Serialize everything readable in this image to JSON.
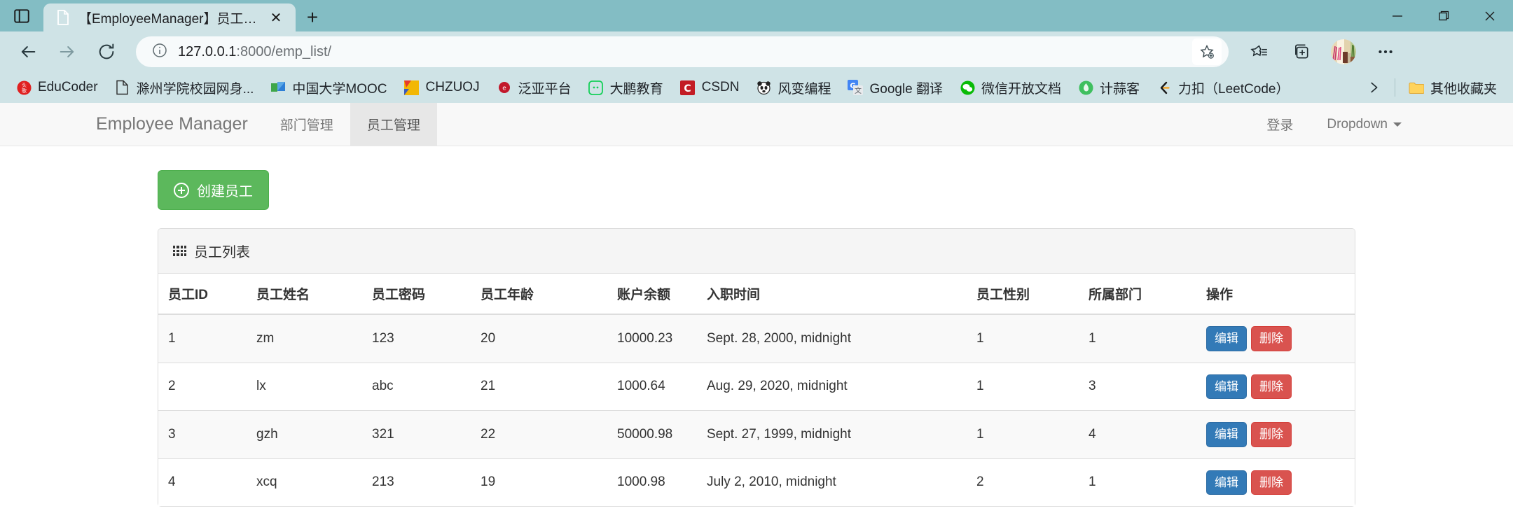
{
  "window": {
    "minimize_label": "Minimize",
    "maximize_label": "Maximize",
    "close_label": "Close"
  },
  "tabstrip": {
    "tab_search_icon": "tab-list-icon",
    "tab_title": "【EmployeeManager】员工列表",
    "tab_close_label": "✕",
    "new_tab_label": "+"
  },
  "toolbar": {
    "back_label": "←",
    "forward_label": "→",
    "reload_label": "⟳",
    "site_info_icon": "info-icon",
    "url_host": "127.0.0.1",
    "url_path": ":8000/emp_list/",
    "url_full": "127.0.0.1:8000/emp_list/",
    "favorite_icon": "star-add-icon",
    "favorites_icon": "favorites-list-icon",
    "collections_icon": "collections-icon",
    "profile_icon": "profile-avatar",
    "settings_icon": "more-options-icon"
  },
  "bookmarks": {
    "items": [
      {
        "label": "EduCoder",
        "icon": "educoder-icon"
      },
      {
        "label": "滁州学院校园网身...",
        "icon": "document-icon"
      },
      {
        "label": "中国大学MOOC",
        "icon": "mooc-icon"
      },
      {
        "label": "CHZUOJ",
        "icon": "chzuoj-icon"
      },
      {
        "label": "泛亚平台",
        "icon": "fanya-icon"
      },
      {
        "label": "大鹏教育",
        "icon": "dapeng-icon"
      },
      {
        "label": "CSDN",
        "icon": "csdn-icon"
      },
      {
        "label": "风变编程",
        "icon": "fengbian-icon"
      },
      {
        "label": "Google 翻译",
        "icon": "google-translate-icon"
      },
      {
        "label": "微信开放文档",
        "icon": "wechat-icon"
      },
      {
        "label": "计蒜客",
        "icon": "jisuanke-icon"
      },
      {
        "label": "力扣（LeetCode）",
        "icon": "leetcode-icon"
      }
    ],
    "overflow_label": "›",
    "other_favorites": {
      "label": "其他收藏夹",
      "icon": "folder-icon"
    }
  },
  "navbar": {
    "brand": "Employee Manager",
    "links": [
      {
        "label": "部门管理",
        "active": false
      },
      {
        "label": "员工管理",
        "active": true
      }
    ],
    "right": [
      {
        "label": "登录"
      },
      {
        "label": "Dropdown",
        "caret": true
      }
    ]
  },
  "main": {
    "create_button": "创建员工",
    "create_icon": "plus-circle-icon",
    "panel_icon": "grid-icon",
    "panel_title": "员工列表",
    "columns": [
      "员工ID",
      "员工姓名",
      "员工密码",
      "员工年龄",
      "账户余额",
      "入职时间",
      "员工性别",
      "所属部门",
      "操作"
    ],
    "rows": [
      {
        "id": "1",
        "name": "zm",
        "password": "123",
        "age": "20",
        "balance": "10000.23",
        "hire_date": "Sept. 28, 2000, midnight",
        "gender": "1",
        "department": "1",
        "edit_label": "编辑",
        "delete_label": "删除"
      },
      {
        "id": "2",
        "name": "lx",
        "password": "abc",
        "age": "21",
        "balance": "1000.64",
        "hire_date": "Aug. 29, 2020, midnight",
        "gender": "1",
        "department": "3",
        "edit_label": "编辑",
        "delete_label": "删除"
      },
      {
        "id": "3",
        "name": "gzh",
        "password": "321",
        "age": "22",
        "balance": "50000.98",
        "hire_date": "Sept. 27, 1999, midnight",
        "gender": "1",
        "department": "4",
        "edit_label": "编辑",
        "delete_label": "删除"
      },
      {
        "id": "4",
        "name": "xcq",
        "password": "213",
        "age": "19",
        "balance": "1000.98",
        "hire_date": "July 2, 2010, midnight",
        "gender": "2",
        "department": "1",
        "edit_label": "编辑",
        "delete_label": "删除"
      }
    ]
  },
  "colors": {
    "chrome": "#83bdc4",
    "toolbar": "#cfe3e6",
    "create_green": "#5cb85c",
    "edit_blue": "#337ab7",
    "delete_red": "#d9534f"
  }
}
